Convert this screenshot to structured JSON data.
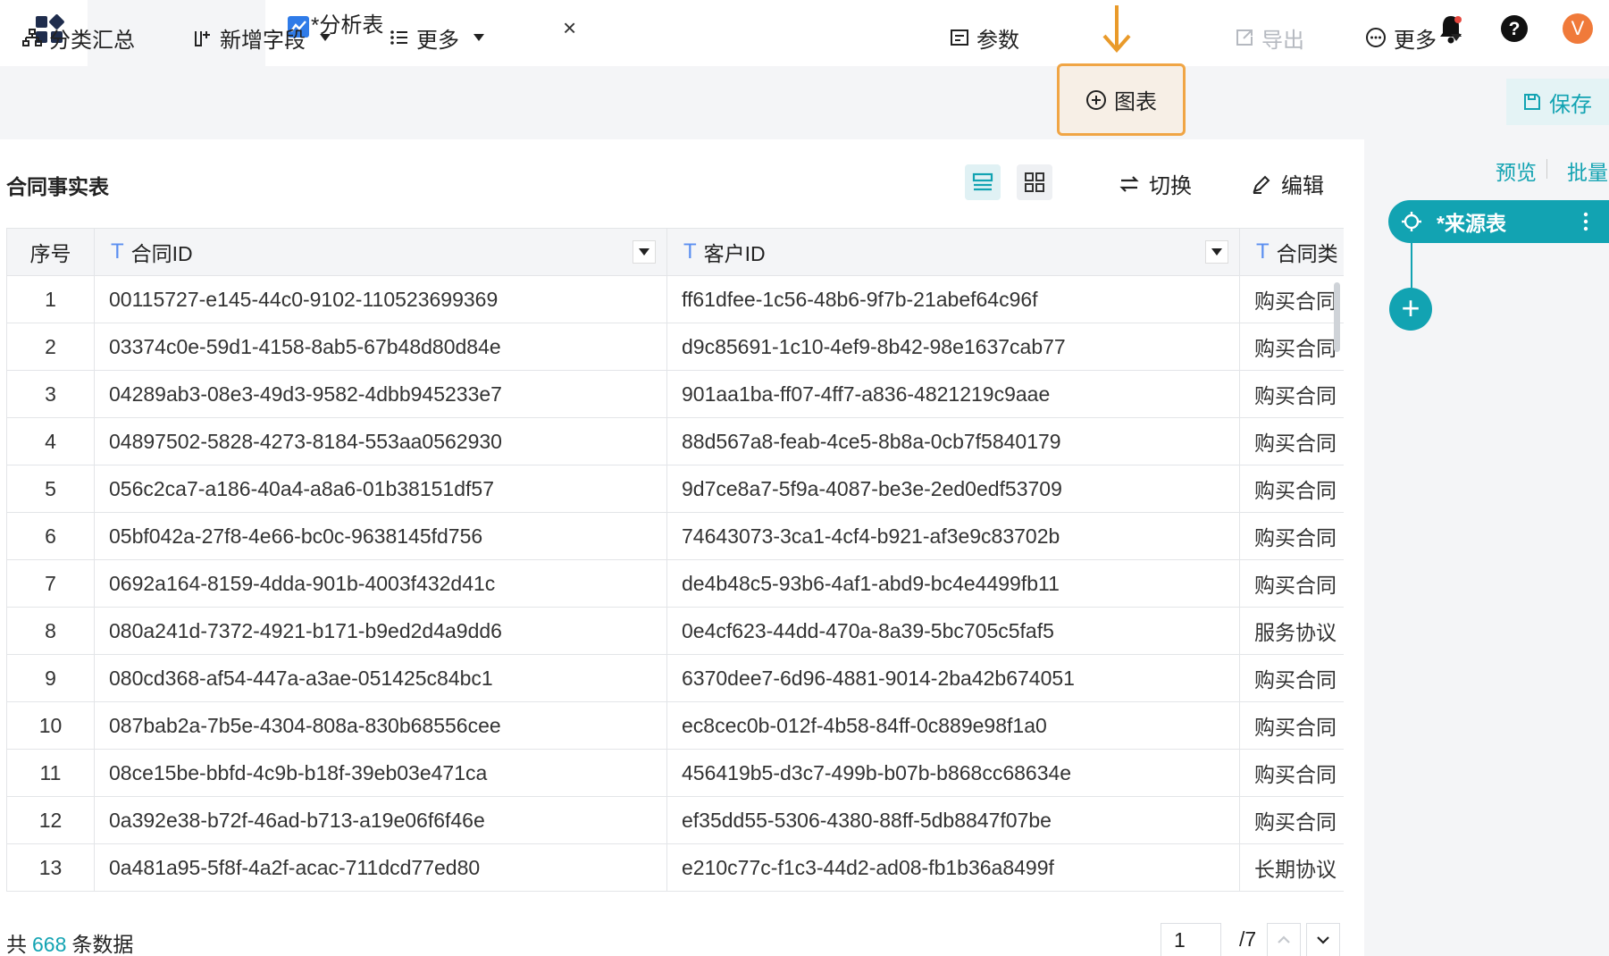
{
  "tab": {
    "title": "*分析表",
    "close": "×"
  },
  "user": {
    "avatar_letter": "V"
  },
  "toolbar": {
    "group_summary": "分类汇总",
    "add_field": "新增字段",
    "more_left": "更多",
    "params": "参数",
    "chart": "图表",
    "export": "导出",
    "more_right": "更多",
    "save": "保存"
  },
  "section": {
    "title": "合同事实表",
    "switch": "切换",
    "edit": "编辑"
  },
  "table": {
    "columns": [
      "序号",
      "合同ID",
      "客户ID",
      "合同类"
    ],
    "rows": [
      [
        "1",
        "00115727-e145-44c0-9102-110523699369",
        "ff61dfee-1c56-48b6-9f7b-21abef64c96f",
        "购买合同"
      ],
      [
        "2",
        "03374c0e-59d1-4158-8ab5-67b48d80d84e",
        "d9c85691-1c10-4ef9-8b42-98e1637cab77",
        "购买合同"
      ],
      [
        "3",
        "04289ab3-08e3-49d3-9582-4dbb945233e7",
        "901aa1ba-ff07-4ff7-a836-4821219c9aae",
        "购买合同"
      ],
      [
        "4",
        "04897502-5828-4273-8184-553aa0562930",
        "88d567a8-feab-4ce5-8b8a-0cb7f5840179",
        "购买合同"
      ],
      [
        "5",
        "056c2ca7-a186-40a4-a8a6-01b38151df57",
        "9d7ce8a7-5f9a-4087-be3e-2ed0edf53709",
        "购买合同"
      ],
      [
        "6",
        "05bf042a-27f8-4e66-bc0c-9638145fd756",
        "74643073-3ca1-4cf4-b921-af3e9c83702b",
        "购买合同"
      ],
      [
        "7",
        "0692a164-8159-4dda-901b-4003f432d41c",
        "de4b48c5-93b6-4af1-abd9-bc4e4499fb11",
        "购买合同"
      ],
      [
        "8",
        "080a241d-7372-4921-b171-b9ed2d4a9dd6",
        "0e4cf623-44dd-470a-8a39-5bc705c5faf5",
        "服务协议"
      ],
      [
        "9",
        "080cd368-af54-447a-a3ae-051425c84bc1",
        "6370dee7-6d96-4881-9014-2ba42b674051",
        "购买合同"
      ],
      [
        "10",
        "087bab2a-7b5e-4304-808a-830b68556cee",
        "ec8cec0b-012f-4b58-84ff-0c889e98f1a0",
        "购买合同"
      ],
      [
        "11",
        "08ce15be-bbfd-4c9b-b18f-39eb03e471ca",
        "456419b5-d3c7-499b-b07b-b868cc68634e",
        "购买合同"
      ],
      [
        "12",
        "0a392e38-b72f-46ad-b713-a19e06f6f46e",
        "ef35dd55-5306-4380-88ff-5db8847f07be",
        "购买合同"
      ],
      [
        "13",
        "0a481a95-5f8f-4a2f-acac-711dcd77ed80",
        "e210c77c-f1c3-44d2-ad08-fb1b36a8499f",
        "长期协议"
      ]
    ]
  },
  "footer": {
    "prefix": "共",
    "count": "668",
    "suffix": "条数据",
    "page": "1",
    "total_pages": "/7"
  },
  "right_panel": {
    "preview": "预览",
    "batch": "批量",
    "source_node": "*来源表"
  },
  "colors": {
    "accent": "#12a3b2",
    "highlight_border": "#f0a545",
    "avatar": "#f07a3a",
    "field_type_icon": "#5b8ff0"
  },
  "icons": {
    "field_type": "T"
  }
}
